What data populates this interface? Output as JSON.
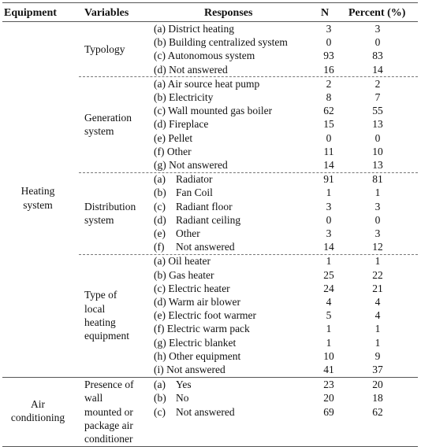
{
  "header": {
    "equipment": "Equipment",
    "variables": "Variables",
    "responses": "Responses",
    "n": "N",
    "percent": "Percent (%)"
  },
  "groups": [
    {
      "equipment": [
        "Heating",
        "system"
      ],
      "variables": [
        {
          "name": [
            "Typology"
          ],
          "style": "compact",
          "rows": [
            {
              "letter": "(a)",
              "label": "District heating",
              "n": "3",
              "pct": "3"
            },
            {
              "letter": "(b)",
              "label": "Building centralized system",
              "n": "0",
              "pct": "0"
            },
            {
              "letter": "(c)",
              "label": "Autonomous system",
              "n": "93",
              "pct": "83"
            },
            {
              "letter": "(d)",
              "label": "Not answered",
              "n": "16",
              "pct": "14"
            }
          ]
        },
        {
          "name": [
            "Generation",
            "system"
          ],
          "style": "compact",
          "rows": [
            {
              "letter": "(a)",
              "label": "Air source heat pump",
              "n": "2",
              "pct": "2"
            },
            {
              "letter": "(b)",
              "label": "Electricity",
              "n": "8",
              "pct": "7"
            },
            {
              "letter": "(c)",
              "label": "Wall mounted gas boiler",
              "n": "62",
              "pct": "55"
            },
            {
              "letter": "(d)",
              "label": "Fireplace",
              "n": "15",
              "pct": "13"
            },
            {
              "letter": "(e)",
              "label": "Pellet",
              "n": "0",
              "pct": "0"
            },
            {
              "letter": "(f)",
              "label": "Other",
              "n": "11",
              "pct": "10"
            },
            {
              "letter": "(g)",
              "label": "Not answered",
              "n": "14",
              "pct": "13"
            }
          ]
        },
        {
          "name": [
            "Distribution",
            "system"
          ],
          "style": "tabbed",
          "rows": [
            {
              "letter": "(a)",
              "label": "Radiator",
              "n": "91",
              "pct": "81"
            },
            {
              "letter": "(b)",
              "label": "Fan Coil",
              "n": "1",
              "pct": "1"
            },
            {
              "letter": "(c)",
              "label": "Radiant floor",
              "n": "3",
              "pct": "3"
            },
            {
              "letter": "(d)",
              "label": "Radiant ceiling",
              "n": "0",
              "pct": "0"
            },
            {
              "letter": "(e)",
              "label": "Other",
              "n": "3",
              "pct": "3"
            },
            {
              "letter": "(f)",
              "label": "Not answered",
              "n": "14",
              "pct": "12"
            }
          ]
        },
        {
          "name": [
            "Type of",
            "local",
            "heating",
            "equipment"
          ],
          "style": "compact",
          "rows": [
            {
              "letter": "(a)",
              "label": "Oil heater",
              "n": "1",
              "pct": "1"
            },
            {
              "letter": "(b)",
              "label": "Gas heater",
              "n": "25",
              "pct": "22"
            },
            {
              "letter": "(c)",
              "label": "Electric heater",
              "n": "24",
              "pct": "21"
            },
            {
              "letter": "(d)",
              "label": "Warm air blower",
              "n": "4",
              "pct": "4"
            },
            {
              "letter": "(e)",
              "label": "Electric foot warmer",
              "n": "5",
              "pct": "4"
            },
            {
              "letter": "(f)",
              "label": "Electric warm pack",
              "n": "1",
              "pct": "1"
            },
            {
              "letter": "(g)",
              "label": "Electric blanket",
              "n": "1",
              "pct": "1"
            },
            {
              "letter": "(h)",
              "label": "Other equipment",
              "n": "10",
              "pct": "9"
            },
            {
              "letter": "(i)",
              "label": "Not answered",
              "n": "41",
              "pct": "37"
            }
          ]
        }
      ]
    },
    {
      "equipment": [
        "Air",
        "conditioning"
      ],
      "variables": [
        {
          "name": [
            "Presence of",
            "wall",
            "mounted or",
            "package air",
            "conditioner"
          ],
          "style": "tabbed",
          "rows": [
            {
              "letter": "(a)",
              "label": "Yes",
              "n": "23",
              "pct": "20"
            },
            {
              "letter": "(b)",
              "label": "No",
              "n": "20",
              "pct": "18"
            },
            {
              "letter": "(c)",
              "label": "Not answered",
              "n": "69",
              "pct": "62"
            }
          ]
        }
      ]
    }
  ]
}
